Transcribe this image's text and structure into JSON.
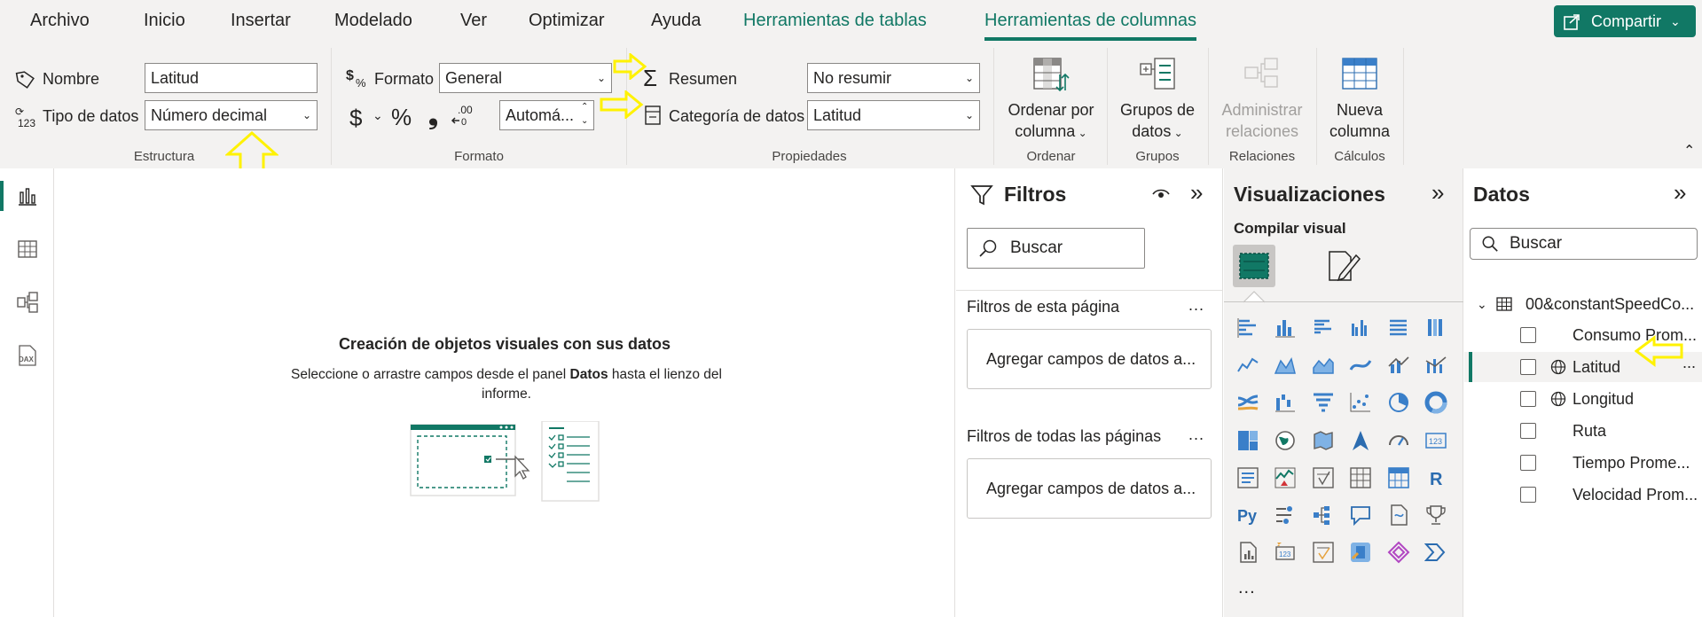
{
  "menu": {
    "tabs": [
      "Archivo",
      "Inicio",
      "Insertar",
      "Modelado",
      "Ver",
      "Optimizar",
      "Ayuda",
      "Herramientas de tablas",
      "Herramientas de columnas"
    ],
    "share_label": "Compartir"
  },
  "ribbon": {
    "estructura": {
      "name_label": "Nombre",
      "name_value": "Latitud",
      "datatype_label": "Tipo de datos",
      "datatype_value": "Número decimal",
      "group_label": "Estructura"
    },
    "formato": {
      "format_label": "Formato",
      "format_value": "General",
      "currency_symbol": "$",
      "percent_symbol": "%",
      "comma_symbol": "❟",
      "decimals_icon": "←.00",
      "auto_value": "Automá...",
      "group_label": "Formato"
    },
    "propiedades": {
      "summary_label": "Resumen",
      "summary_value": "No resumir",
      "category_label": "Categoría de datos",
      "category_value": "Latitud",
      "group_label": "Propiedades"
    },
    "ordenar": {
      "button_label_1": "Ordenar por",
      "button_label_2": "columna",
      "group_label": "Ordenar"
    },
    "grupos": {
      "button_label_1": "Grupos de",
      "button_label_2": "datos",
      "group_label": "Grupos"
    },
    "relaciones": {
      "button_label_1": "Administrar",
      "button_label_2": "relaciones",
      "group_label": "Relaciones"
    },
    "calculos": {
      "button_label_1": "Nueva",
      "button_label_2": "columna",
      "group_label": "Cálculos"
    }
  },
  "canvas": {
    "title": "Creación de objetos visuales con sus datos",
    "subtitle_pre": "Seleccione o arrastre campos desde el panel ",
    "subtitle_bold": "Datos",
    "subtitle_post": " hasta el lienzo del informe."
  },
  "filters": {
    "title": "Filtros",
    "search_placeholder": "Buscar",
    "page_filters_label": "Filtros de esta página",
    "page_drop_label": "Agregar campos de datos a...",
    "all_filters_label": "Filtros de todas las páginas",
    "all_drop_label": "Agregar campos de datos a...",
    "more": "..."
  },
  "visualizations": {
    "title": "Visualizaciones",
    "build_label": "Compilar visual",
    "more": "..."
  },
  "data": {
    "title": "Datos",
    "search_placeholder": "Buscar",
    "table_name": "00&constantSpeedCo...",
    "fields": [
      {
        "label": "Consumo Prom...",
        "geo": false,
        "selected": false
      },
      {
        "label": "Latitud",
        "geo": true,
        "selected": true
      },
      {
        "label": "Longitud",
        "geo": true,
        "selected": false
      },
      {
        "label": "Ruta",
        "geo": false,
        "selected": false
      },
      {
        "label": "Tiempo Prome...",
        "geo": false,
        "selected": false
      },
      {
        "label": "Velocidad Prom...",
        "geo": false,
        "selected": false
      }
    ],
    "more": "..."
  },
  "colors": {
    "accent": "#117865",
    "arrow": "#fff200"
  }
}
